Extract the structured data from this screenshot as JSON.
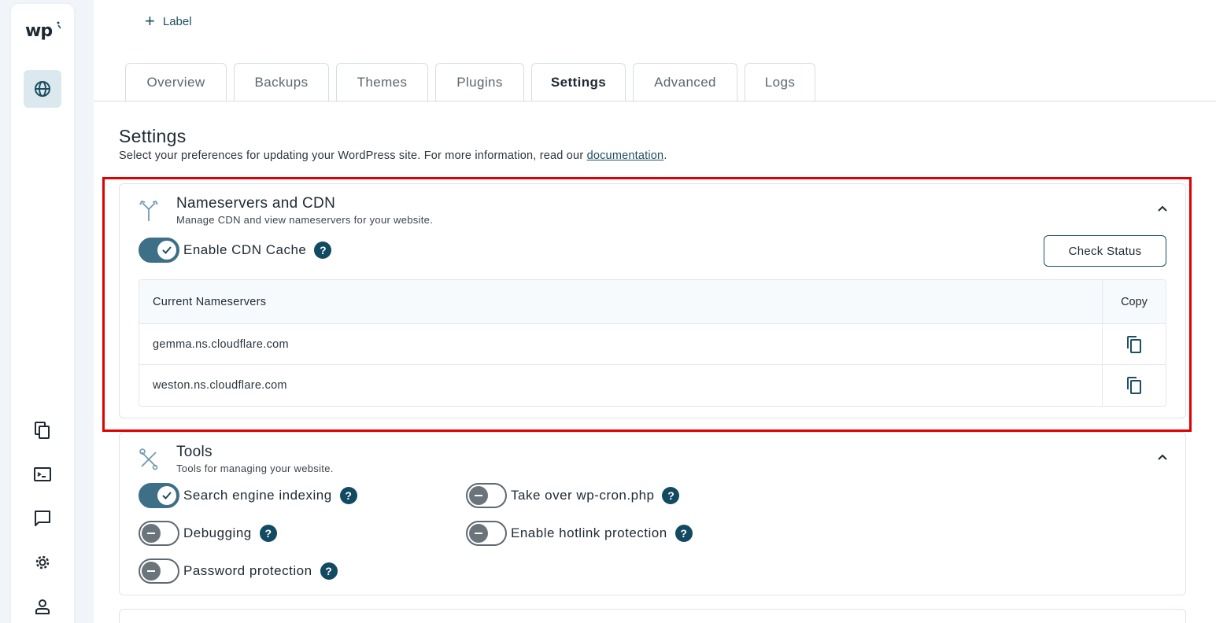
{
  "sidebar": {
    "logo": "wp",
    "items": [
      {
        "icon": "globe-icon"
      },
      {
        "icon": "copy-pages-icon"
      },
      {
        "icon": "terminal-icon"
      },
      {
        "icon": "chat-icon"
      },
      {
        "icon": "gear-icon"
      },
      {
        "icon": "user-icon"
      }
    ]
  },
  "header": {
    "add_label": "Label"
  },
  "tabs": [
    {
      "label": "Overview"
    },
    {
      "label": "Backups"
    },
    {
      "label": "Themes"
    },
    {
      "label": "Plugins"
    },
    {
      "label": "Settings",
      "active": true
    },
    {
      "label": "Advanced"
    },
    {
      "label": "Logs"
    }
  ],
  "page": {
    "title": "Settings",
    "description": "Select your preferences for updating your WordPress site. For more information, read our ",
    "doc_link": "documentation",
    "description_end": "."
  },
  "nameservers": {
    "title": "Nameservers and CDN",
    "subtitle": "Manage CDN and view nameservers for your website.",
    "cdn_toggle": {
      "label": "Enable CDN Cache",
      "on": true
    },
    "check_status": "Check Status",
    "table": {
      "headers": [
        "Current Nameservers",
        "Copy"
      ],
      "rows": [
        "gemma.ns.cloudflare.com",
        "weston.ns.cloudflare.com"
      ]
    }
  },
  "tools": {
    "title": "Tools",
    "subtitle": "Tools for managing your website.",
    "toggles": [
      {
        "label": "Search engine indexing",
        "on": true
      },
      {
        "label": "Take over wp-cron.php",
        "on": false
      },
      {
        "label": "Debugging",
        "on": false
      },
      {
        "label": "Enable hotlink protection",
        "on": false
      },
      {
        "label": "Password protection",
        "on": false
      }
    ]
  },
  "colors": {
    "accent": "#1d4e63",
    "toggle_on": "#3d6f87",
    "highlight": "#e00000"
  }
}
